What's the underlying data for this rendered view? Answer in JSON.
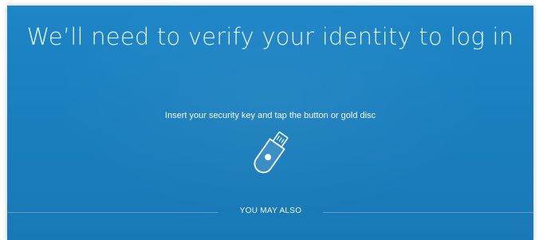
{
  "page": {
    "title": "We’ll need to verify your identity to log in",
    "instruction": "Insert your security key and tap the button or gold disc",
    "security_key_icon": "usb-security-key-icon",
    "divider_label": "YOU MAY ALSO"
  },
  "colors": {
    "panel_background": "#1a7fbe",
    "text": "#eaf4fb",
    "key_outline": "#ffffff"
  }
}
